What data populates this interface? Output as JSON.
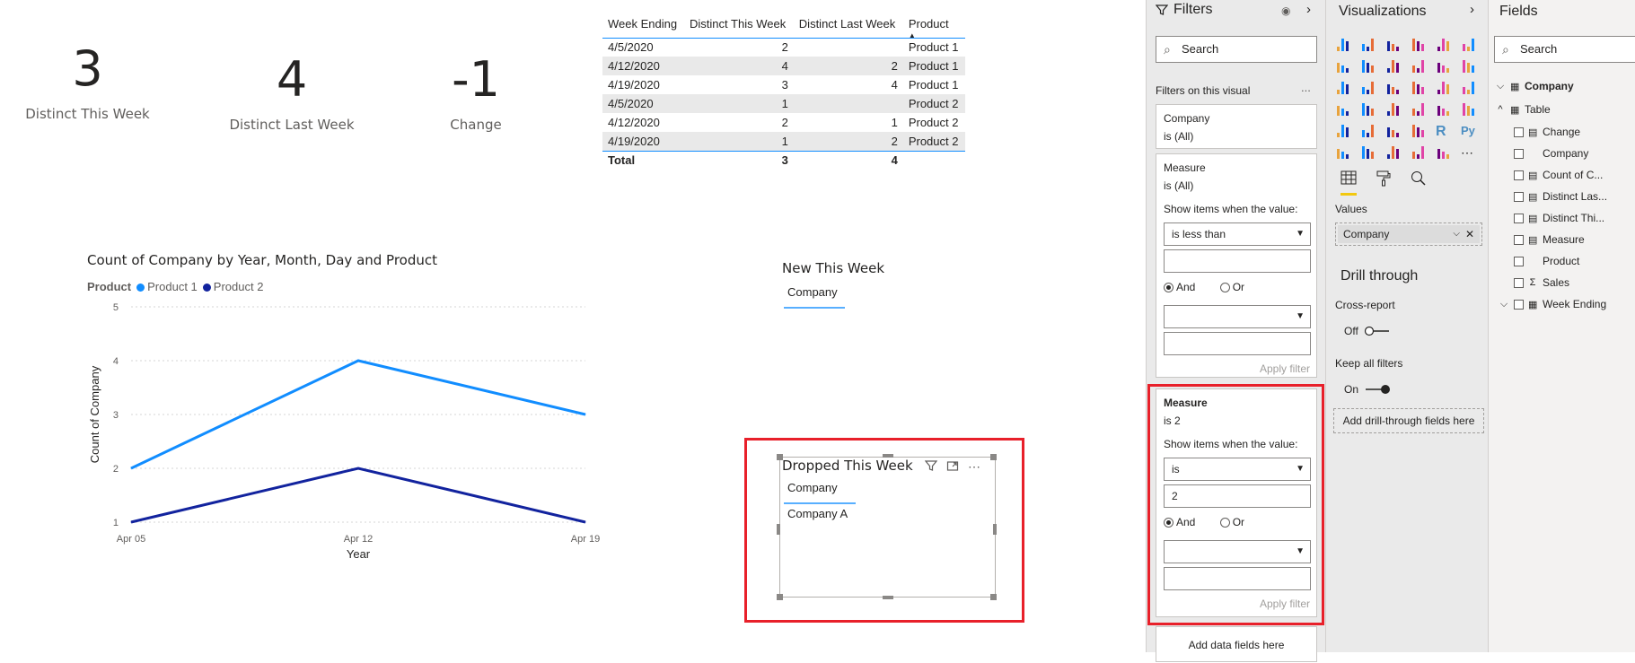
{
  "cards": [
    {
      "value": "3",
      "label": "Distinct This Week"
    },
    {
      "value": "4",
      "label": "Distinct Last Week"
    },
    {
      "value": "-1",
      "label": "Change"
    }
  ],
  "table": {
    "headers": [
      "Week Ending",
      "Distinct This Week",
      "Distinct Last Week",
      "Product"
    ],
    "rows": [
      [
        "4/5/2020",
        "2",
        "",
        "Product 1"
      ],
      [
        "4/12/2020",
        "4",
        "2",
        "Product 1"
      ],
      [
        "4/19/2020",
        "3",
        "4",
        "Product 1"
      ],
      [
        "4/5/2020",
        "1",
        "",
        "Product 2"
      ],
      [
        "4/12/2020",
        "2",
        "1",
        "Product 2"
      ],
      [
        "4/19/2020",
        "1",
        "2",
        "Product 2"
      ]
    ],
    "total": [
      "Total",
      "3",
      "4",
      ""
    ]
  },
  "chart_data": {
    "type": "line",
    "title": "Count of Company by Year, Month, Day and Product",
    "legend_title": "Product",
    "legend_position": "top-left",
    "x": [
      "Apr 05",
      "Apr 12",
      "Apr 19"
    ],
    "xlabel": "Year",
    "ylabel": "Count of Company",
    "ylim": [
      1,
      5
    ],
    "yticks": [
      "1",
      "2",
      "3",
      "4",
      "5"
    ],
    "grid": true,
    "series": [
      {
        "name": "Product 1",
        "values": [
          2,
          4,
          3
        ],
        "color": "#118dff"
      },
      {
        "name": "Product 2",
        "values": [
          1,
          2,
          1
        ],
        "color": "#12239e"
      }
    ]
  },
  "new_this_week": {
    "title": "New This Week",
    "column": "Company",
    "rows": []
  },
  "dropped_this_week": {
    "title": "Dropped This Week",
    "column": "Company",
    "rows": [
      "Company A"
    ]
  },
  "filters": {
    "title": "Filters",
    "search_placeholder": "Search",
    "section": "Filters on this visual",
    "more": "...",
    "cards": [
      {
        "name": "Company",
        "state": "is (All)"
      },
      {
        "name": "Measure",
        "state": "is (All)",
        "show_label": "Show items when the value:",
        "condition": "is less than",
        "value": "",
        "and": "And",
        "or": "Or",
        "apply": "Apply filter"
      },
      {
        "name": "Measure",
        "state": "is 2",
        "show_label": "Show items when the value:",
        "condition": "is",
        "value": "2",
        "and": "And",
        "or": "Or",
        "apply": "Apply filter"
      }
    ],
    "add_fields": "Add data fields here"
  },
  "visualizations": {
    "title": "Visualizations",
    "values_label": "Values",
    "values_field": "Company",
    "drill_title": "Drill through",
    "cross_report": "Cross-report",
    "cross_state": "Off",
    "keep_filters": "Keep all filters",
    "keep_state": "On",
    "add_drill": "Add drill-through fields here",
    "more_icon": "..."
  },
  "fields": {
    "title": "Fields",
    "search_placeholder": "Search",
    "tables": [
      {
        "name": "Company"
      },
      {
        "name": "Table"
      }
    ],
    "items": [
      "Change",
      "Company",
      "Count of C...",
      "Distinct Las...",
      "Distinct Thi...",
      "Measure",
      "Product",
      "Sales",
      "Week Ending"
    ]
  },
  "colors": {
    "accent": "#118dff",
    "series2": "#12239e",
    "highlight": "#e8202a"
  }
}
